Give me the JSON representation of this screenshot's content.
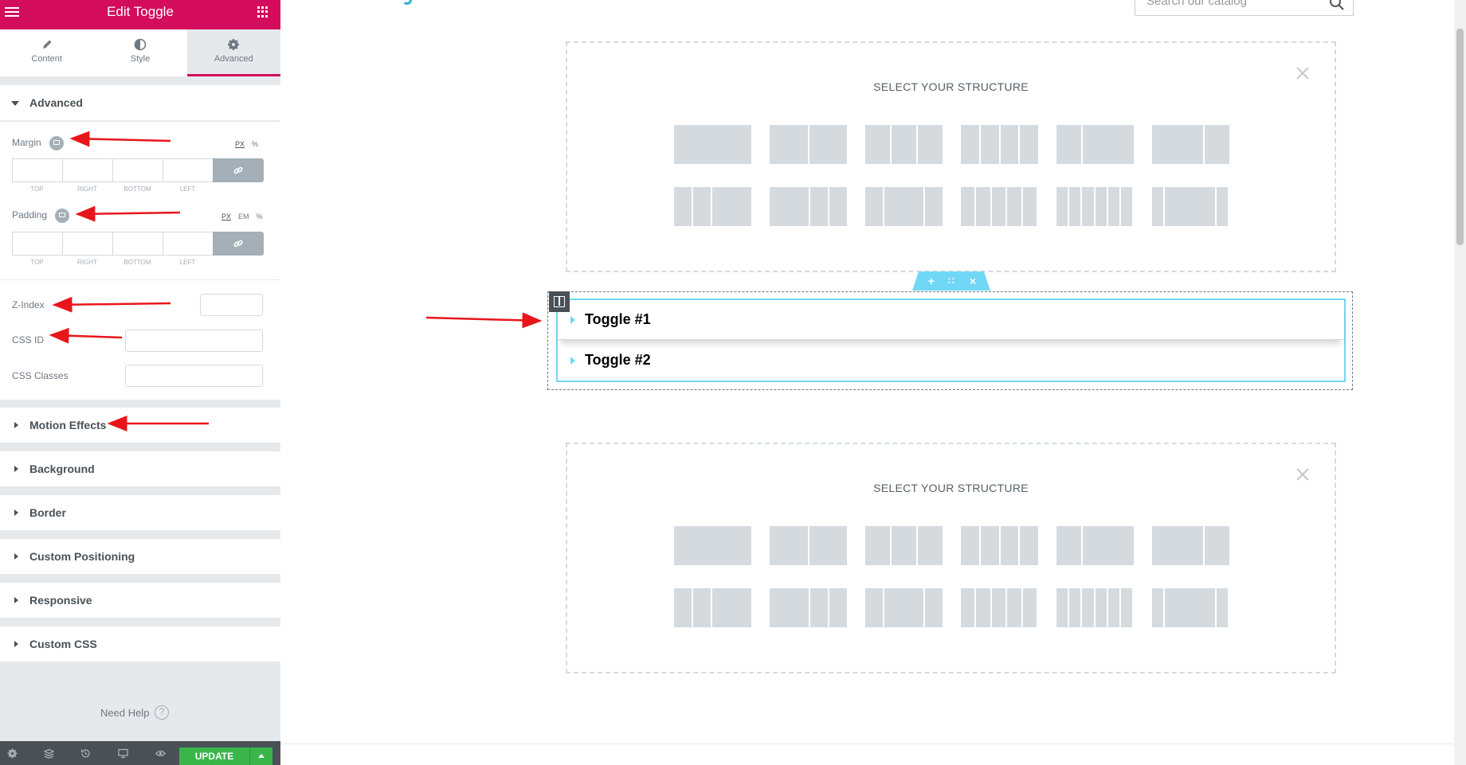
{
  "panel": {
    "title": "Edit Toggle",
    "tabs": [
      {
        "label": "Content",
        "icon": "pencil-icon"
      },
      {
        "label": "Style",
        "icon": "contrast-icon"
      },
      {
        "label": "Advanced",
        "icon": "gear-icon",
        "active": true
      }
    ],
    "sections": {
      "advanced": "Advanced",
      "motion_effects": "Motion Effects",
      "background": "Background",
      "border": "Border",
      "custom_positioning": "Custom Positioning",
      "responsive": "Responsive",
      "custom_css": "Custom CSS"
    },
    "controls": {
      "margin": {
        "label": "Margin",
        "units": [
          "PX",
          "%"
        ],
        "selected_unit": "PX"
      },
      "padding": {
        "label": "Padding",
        "units": [
          "PX",
          "EM",
          "%"
        ],
        "selected_unit": "PX"
      },
      "dimension_labels": [
        "TOP",
        "RIGHT",
        "BOTTOM",
        "LEFT"
      ],
      "z_index": {
        "label": "Z-Index",
        "value": ""
      },
      "css_id": {
        "label": "CSS ID",
        "value": ""
      },
      "css_classes": {
        "label": "CSS Classes",
        "value": ""
      }
    },
    "need_help": "Need Help",
    "help_glyph": "?",
    "footer": {
      "icons": [
        "settings-icon",
        "navigator-icon",
        "history-icon",
        "responsive-icon",
        "preview-icon"
      ],
      "update_label": "UPDATE"
    },
    "accent_color": "#d30c5c",
    "update_color": "#39b54a"
  },
  "preview": {
    "search": {
      "placeholder": "Search our catalog"
    },
    "structure_title": "SELECT YOUR STRUCTURE",
    "section_handle_icons": [
      "plus-icon",
      "drag-icon",
      "close-icon"
    ],
    "handle_glyphs": {
      "add": "+",
      "drag": "∷",
      "close": "×"
    },
    "toggles": [
      {
        "title": "Toggle #1"
      },
      {
        "title": "Toggle #2"
      }
    ],
    "toggle_border_color": "#71d7f7"
  }
}
